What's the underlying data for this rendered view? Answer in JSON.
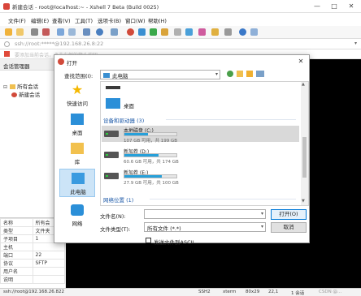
{
  "window": {
    "title": "新建会话 - root@localhost:~ - Xshell 7 Beta (Build 0025)",
    "controls": [
      "—",
      "□",
      "✕"
    ]
  },
  "menu": [
    "文件(F)",
    "编辑(E)",
    "查看(V)",
    "工具(T)",
    "选项卡(B)",
    "窗口(W)",
    "帮助(H)"
  ],
  "address": "ssh://root:*****@192.168.26.8:22",
  "hint": "要添加当前会话，点击左侧的箭头按钮。",
  "session_manager": {
    "title": "会话管理器",
    "tree": [
      {
        "label": "所有会话"
      },
      {
        "label": "新建会话"
      }
    ]
  },
  "properties": [
    {
      "key": "名称",
      "value": "所有会"
    },
    {
      "key": "类型",
      "value": "文件夹"
    },
    {
      "key": "子项目",
      "value": "1"
    },
    {
      "key": "主机",
      "value": ""
    },
    {
      "key": "端口",
      "value": "22"
    },
    {
      "key": "协议",
      "value": "SFTP"
    },
    {
      "key": "用户名",
      "value": ""
    },
    {
      "key": "说明",
      "value": ""
    }
  ],
  "status": {
    "left": "ssh://root@192.168.26.822",
    "ssh": "SSH2",
    "term": "xterm",
    "size": "80x29",
    "pos": "22,1",
    "sessions": "1 会话",
    "watermark": "CSDN @..."
  },
  "dialog": {
    "title": "打开",
    "close": "✕",
    "lookin_label": "查找范围(I):",
    "lookin_value": "此电脑",
    "places": [
      {
        "label": "快速访问"
      },
      {
        "label": "桌面"
      },
      {
        "label": "库"
      },
      {
        "label": "此电脑"
      },
      {
        "label": "网络"
      }
    ],
    "folders": [
      {
        "label": "桌面"
      }
    ],
    "devices_header": "设备和驱动器 (3)",
    "drives": [
      {
        "name": "本地磁盘 (C:)",
        "info": "107 GB 可用，共 199 GB",
        "used": 0.46
      },
      {
        "name": "新加卷 (D:)",
        "info": "60.6 GB 可用，共 174 GB",
        "used": 0.65
      },
      {
        "name": "新加卷 (E:)",
        "info": "27.9 GB 可用，共 100 GB",
        "used": 0.72
      }
    ],
    "network_header": "网络位置 (1)",
    "filename_label": "文件名(N):",
    "filename_value": "",
    "filetype_label": "文件类型(T):",
    "filetype_value": "所有文件 (*.*)",
    "open_button": "打开(O)",
    "cancel_button": "取消",
    "ascii_label": "发送文件到ASCII"
  }
}
